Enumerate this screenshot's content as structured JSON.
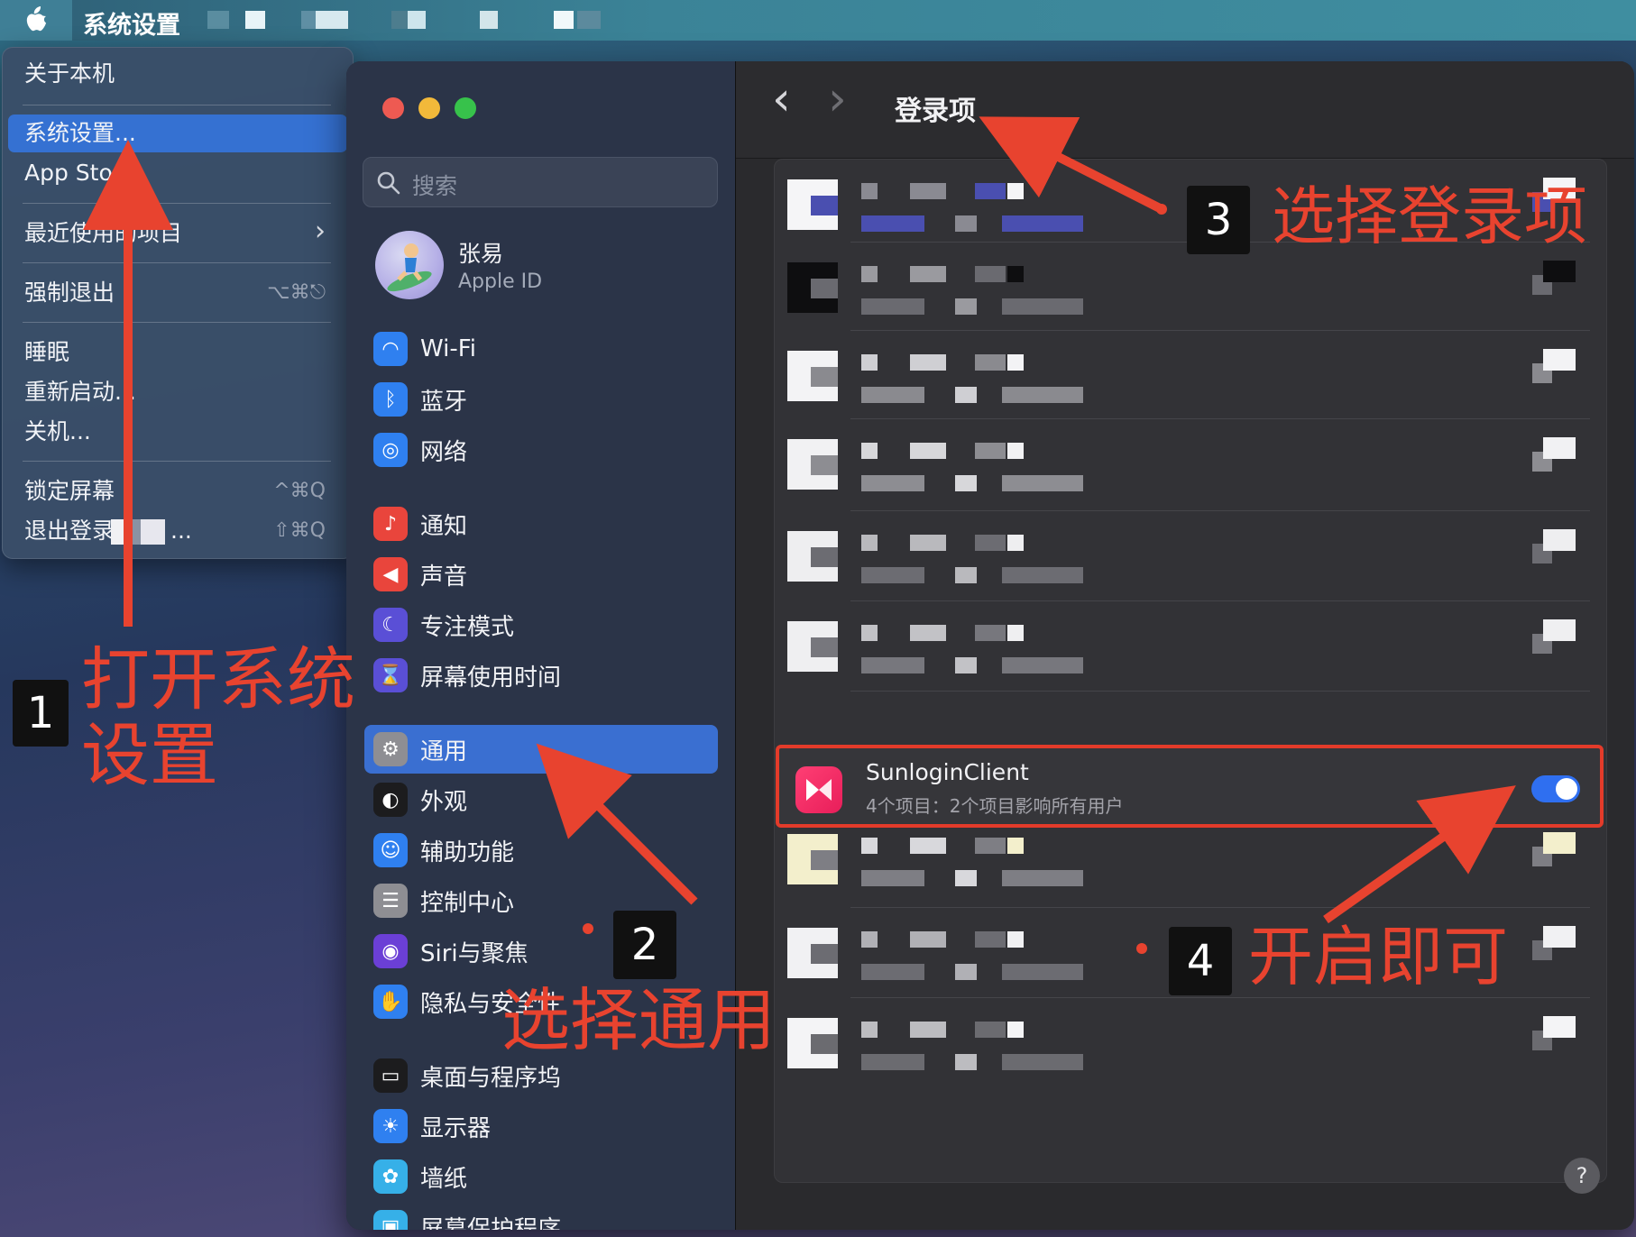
{
  "menubar": {
    "app_title": "系统设置"
  },
  "apple_menu": {
    "items": [
      {
        "label": "关于本机"
      },
      {
        "label": "系统设置..."
      },
      {
        "label": "App Store"
      },
      {
        "label": "最近使用的项目"
      },
      {
        "label": "强制退出",
        "shortcut": "⌥⌘⎋"
      },
      {
        "label": "睡眠"
      },
      {
        "label": "重新启动..."
      },
      {
        "label": "关机..."
      },
      {
        "label": "锁定屏幕",
        "shortcut": "^⌘Q"
      },
      {
        "label": "退出登录",
        "shortcut": "⇧⌘Q"
      }
    ],
    "recent_chevron": "›",
    "logout_suffix": "..."
  },
  "sidebar": {
    "search_placeholder": "搜索",
    "user": {
      "name": "张易",
      "subtitle": "Apple ID"
    },
    "items": [
      {
        "label": "Wi-Fi",
        "icon": "wifi-icon",
        "color": "#2f80f0"
      },
      {
        "label": "蓝牙",
        "icon": "bluetooth-icon",
        "color": "#2f80f0"
      },
      {
        "label": "网络",
        "icon": "globe-icon",
        "color": "#2f80f0"
      },
      {
        "label": "通知",
        "icon": "bell-icon",
        "color": "#e9453c"
      },
      {
        "label": "声音",
        "icon": "speaker-icon",
        "color": "#e9453c"
      },
      {
        "label": "专注模式",
        "icon": "moon-icon",
        "color": "#5a4fd6"
      },
      {
        "label": "屏幕使用时间",
        "icon": "hourglass-icon",
        "color": "#5a4fd6"
      },
      {
        "label": "通用",
        "icon": "gear-icon",
        "color": "#8e8e93"
      },
      {
        "label": "外观",
        "icon": "appearance-icon",
        "color": "#1c1c1e"
      },
      {
        "label": "辅助功能",
        "icon": "accessibility-icon",
        "color": "#2f80f0"
      },
      {
        "label": "控制中心",
        "icon": "control-center-icon",
        "color": "#8e8e93"
      },
      {
        "label": "Siri与聚焦",
        "icon": "siri-icon",
        "color": "#6b3fd6"
      },
      {
        "label": "隐私与安全性",
        "icon": "hand-icon",
        "color": "#2f80f0"
      },
      {
        "label": "桌面与程序坞",
        "icon": "dock-icon",
        "color": "#1c1c1e"
      },
      {
        "label": "显示器",
        "icon": "sun-icon",
        "color": "#2f80f0"
      },
      {
        "label": "墙纸",
        "icon": "flower-icon",
        "color": "#36b0e8"
      },
      {
        "label": "屏幕保护程序",
        "icon": "screensaver-icon",
        "color": "#36b0e8"
      }
    ]
  },
  "main": {
    "title": "登录项",
    "back": "‹",
    "forward": "›",
    "highlighted_item": {
      "name": "SunloginClient",
      "subtitle": "4个项目：2个项目影响所有用户",
      "enabled": true
    },
    "help": "?"
  },
  "annotations": {
    "steps": [
      {
        "num": "1",
        "text": "打开系统\n设置"
      },
      {
        "num": "2",
        "text": "选择通用"
      },
      {
        "num": "3",
        "text": "选择登录项"
      },
      {
        "num": "4",
        "text": "开启即可"
      }
    ],
    "accent_color": "#e8432f"
  }
}
